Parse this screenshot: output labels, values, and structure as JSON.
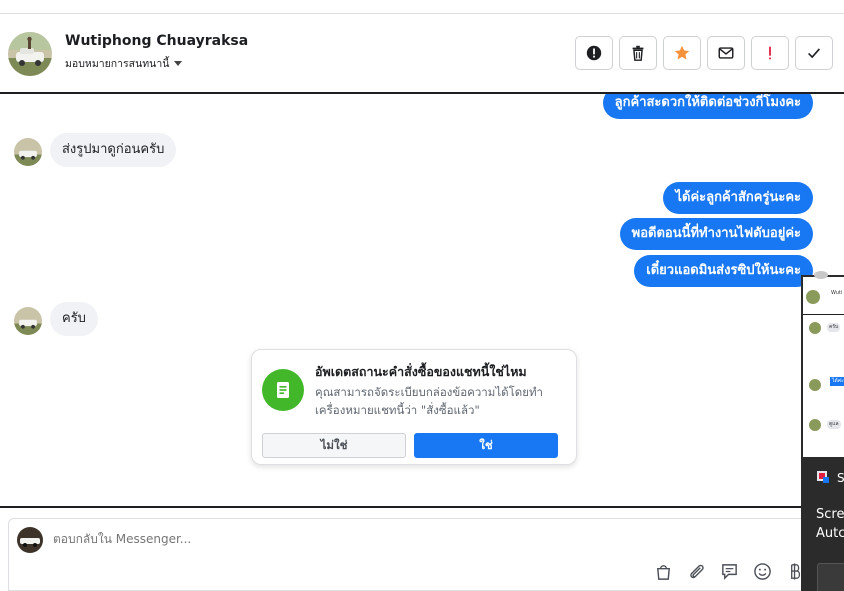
{
  "header": {
    "name": "Wutiphong Chuayraksa",
    "assign_label": "มอบหมายการสนทนานี้",
    "actions": [
      {
        "name": "mark-spam-button",
        "icon": "exclamation-circle-icon"
      },
      {
        "name": "delete-button",
        "icon": "trash-icon"
      },
      {
        "name": "star-button",
        "icon": "star-icon"
      },
      {
        "name": "mark-unread-button",
        "icon": "envelope-icon"
      },
      {
        "name": "follow-up-button",
        "icon": "red-exclamation-icon"
      },
      {
        "name": "mark-done-button",
        "icon": "checkmark-icon"
      }
    ]
  },
  "messages": [
    {
      "dir": "out",
      "text": "ลูกค้าสะดวกให้ติดต่อช่วงกี่โมงคะ"
    },
    {
      "dir": "in",
      "text": "ส่งรูปมาดูก่อนครับ"
    },
    {
      "dir": "out",
      "text": "ได้ค่ะลูกค้าสักครู่นะคะ"
    },
    {
      "dir": "out",
      "text": "พอดีตอนนี้ที่ทำงานไฟดับอยู่ค่ะ"
    },
    {
      "dir": "out",
      "text": "เดี๋ยวแอดมินส่งรซิปให้นะคะ"
    },
    {
      "dir": "in",
      "text": "ครับ"
    }
  ],
  "order_card": {
    "title": "อัพเดตสถานะคำสั่งซื้อของแชทนี้ใช่ไหม",
    "body": "คุณสามารถจัดระเบียบกล่องข้อความได้โดยทำเครื่องหมายแชทนี้ว่า \"สั่งซื้อแล้ว\"",
    "no_label": "ไม่ใช่",
    "yes_label": "ใช่"
  },
  "composer": {
    "placeholder": "ตอบกลับใน Messenger...",
    "tools": [
      "shopping-bag-icon",
      "paperclip-icon",
      "saved-reply-icon",
      "emoji-icon",
      "baht-icon"
    ]
  },
  "popup": {
    "preview_name": "Wuti",
    "preview_in_1": "ครับ",
    "preview_out_1": "ได้ค่ะ",
    "preview_in_2": "ดูแล",
    "app_letter": "S",
    "line1": "Scree",
    "line2": "Autc"
  },
  "colors": {
    "primary": "#1877f2",
    "bubble_in": "#f0f2f5",
    "success": "#42b72a",
    "star": "#f7923b",
    "alert_red": "#e41e3f"
  }
}
